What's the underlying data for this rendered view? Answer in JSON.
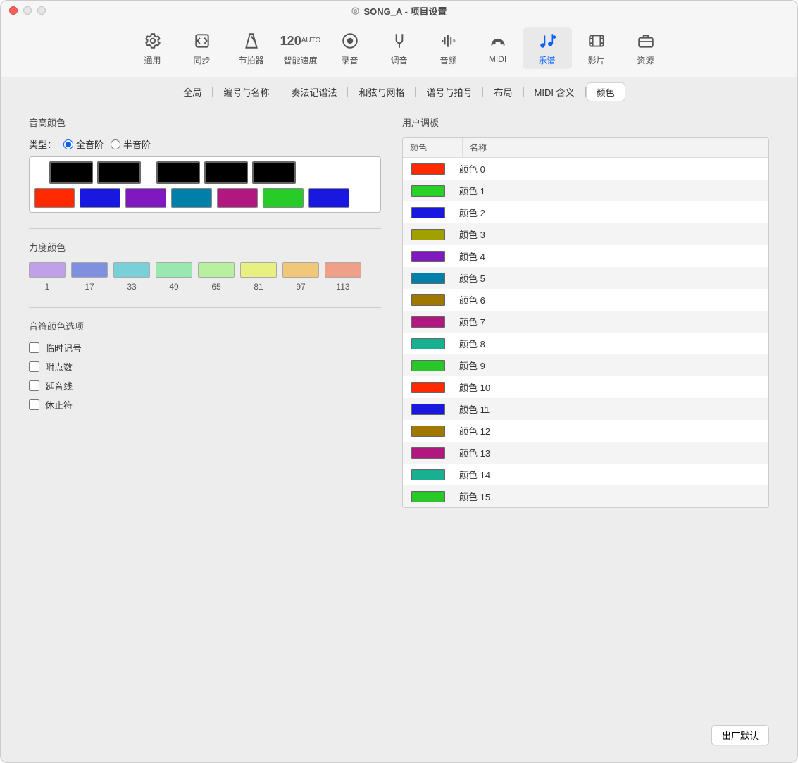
{
  "window": {
    "title": "SONG_A - 项目设置"
  },
  "toolbar": [
    {
      "id": "general",
      "label": "通用"
    },
    {
      "id": "sync",
      "label": "同步"
    },
    {
      "id": "metronome",
      "label": "节拍器"
    },
    {
      "id": "smart-tempo",
      "label": "智能速度",
      "bpm": "120",
      "auto": "AUTO"
    },
    {
      "id": "record",
      "label": "录音"
    },
    {
      "id": "tuning",
      "label": "调音"
    },
    {
      "id": "audio",
      "label": "音频"
    },
    {
      "id": "midi",
      "label": "MIDI"
    },
    {
      "id": "score",
      "label": "乐谱",
      "active": true
    },
    {
      "id": "movie",
      "label": "影片"
    },
    {
      "id": "assets",
      "label": "资源"
    }
  ],
  "tabs": [
    {
      "label": "全局"
    },
    {
      "label": "编号与名称"
    },
    {
      "label": "奏法记谱法"
    },
    {
      "label": "和弦与网格"
    },
    {
      "label": "谱号与拍号"
    },
    {
      "label": "布局"
    },
    {
      "label": "MIDI 含义"
    },
    {
      "label": "颜色",
      "active": true
    }
  ],
  "pitch": {
    "heading": "音高颜色",
    "typeLabel": "类型：",
    "radio1": "全音阶",
    "radio2": "半音阶",
    "whiteKeys": [
      "#ff2a00",
      "#1818e0",
      "#8018c0",
      "#0080a8",
      "#b01880",
      "#28cc28",
      "#1818e0"
    ]
  },
  "velocity": {
    "heading": "力度颜色",
    "swatches": [
      {
        "c": "#c0a0e8",
        "n": "1"
      },
      {
        "c": "#8090e0",
        "n": "17"
      },
      {
        "c": "#78d0d8",
        "n": "33"
      },
      {
        "c": "#98e8b0",
        "n": "49"
      },
      {
        "c": "#b8f0a0",
        "n": "65"
      },
      {
        "c": "#e8f080",
        "n": "81"
      },
      {
        "c": "#f0c878",
        "n": "97"
      },
      {
        "c": "#f0a088",
        "n": "113"
      }
    ]
  },
  "noteOpts": {
    "heading": "音符颜色选项",
    "items": [
      "临时记号",
      "附点数",
      "延音线",
      "休止符"
    ]
  },
  "palette": {
    "heading": "用户调板",
    "colColor": "颜色",
    "colName": "名称",
    "rows": [
      {
        "c": "#ff2a00",
        "n": "颜色 0"
      },
      {
        "c": "#28d028",
        "n": "颜色 1"
      },
      {
        "c": "#1818e0",
        "n": "颜色 2"
      },
      {
        "c": "#a0a000",
        "n": "颜色 3"
      },
      {
        "c": "#8018c0",
        "n": "颜色 4"
      },
      {
        "c": "#0080a8",
        "n": "颜色 5"
      },
      {
        "c": "#a07800",
        "n": "颜色 6"
      },
      {
        "c": "#b01880",
        "n": "颜色 7"
      },
      {
        "c": "#18b090",
        "n": "颜色 8"
      },
      {
        "c": "#28c828",
        "n": "颜色 9"
      },
      {
        "c": "#ff2a00",
        "n": "颜色 10"
      },
      {
        "c": "#1818e0",
        "n": "颜色 11"
      },
      {
        "c": "#a07800",
        "n": "颜色 12"
      },
      {
        "c": "#b01880",
        "n": "颜色 13"
      },
      {
        "c": "#18b090",
        "n": "颜色 14"
      },
      {
        "c": "#28c828",
        "n": "颜色 15"
      }
    ]
  },
  "footer": {
    "factoryDefault": "出厂默认"
  }
}
